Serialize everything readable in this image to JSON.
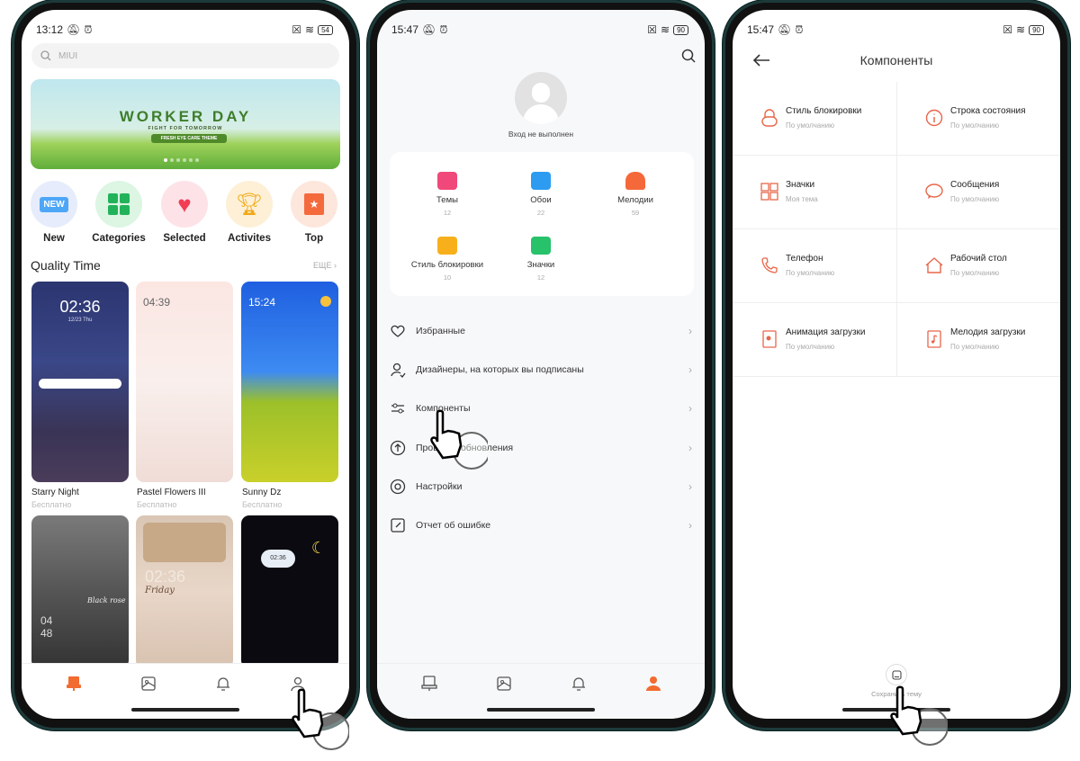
{
  "home": {
    "status": {
      "time": "13:12",
      "battery": "54"
    },
    "search": {
      "placeholder": "MIUI"
    },
    "banner": {
      "title": "WORKER DAY",
      "subtitle": "FIGHT FOR TOMORROW",
      "badge": "FRESH EYE CARE THEME"
    },
    "categories": [
      {
        "label": "New",
        "icon": "new-badge-icon"
      },
      {
        "label": "Categories",
        "icon": "grid-icon"
      },
      {
        "label": "Selected",
        "icon": "heart-icon"
      },
      {
        "label": "Activites",
        "icon": "trophy-icon"
      },
      {
        "label": "Top",
        "icon": "ribbon-star-icon"
      }
    ],
    "section": {
      "title": "Quality Time",
      "more": "ЕЩЕ"
    },
    "themes": [
      {
        "name": "Starry Night",
        "price": "Бесплатно",
        "clock": "02:36",
        "date": "12/23 Thu"
      },
      {
        "name": "Pastel Flowers III",
        "price": "Бесплатно",
        "clock": "04:39"
      },
      {
        "name": "Sunny Dz",
        "price": "Бесплатно",
        "clock": "15:24"
      },
      {
        "clock": "04 48",
        "caption": "Black rose"
      },
      {
        "clock": "02:36",
        "caption": "Friday"
      },
      {
        "clock": "02:36"
      }
    ],
    "nav": [
      "themes",
      "wallpapers",
      "ringtones",
      "profile"
    ],
    "accent": "#f26b2f"
  },
  "profile": {
    "status": {
      "time": "15:47",
      "battery": "90"
    },
    "login_text": "Вход не выполнен",
    "grid": [
      {
        "label": "Темы",
        "count": "12",
        "color": "#f0487a"
      },
      {
        "label": "Обои",
        "count": "22",
        "color": "#2d9cf0"
      },
      {
        "label": "Мелодии",
        "count": "59",
        "color": "#f5683a"
      },
      {
        "label": "Стиль блокировки",
        "count": "10",
        "color": "#f7b01c"
      },
      {
        "label": "Значки",
        "count": "12",
        "color": "#27c26a"
      }
    ],
    "menu": [
      {
        "label": "Избранные",
        "icon": "heart-icon"
      },
      {
        "label": "Дизайнеры, на которых вы подписаны",
        "icon": "user-check-icon"
      },
      {
        "label": "Компоненты",
        "icon": "sliders-icon"
      },
      {
        "label": "Проверка обновления",
        "icon": "arrow-up-circle-icon"
      },
      {
        "label": "Настройки",
        "icon": "settings-icon"
      },
      {
        "label": "Отчет об ошибке",
        "icon": "edit-square-icon"
      }
    ]
  },
  "components": {
    "status": {
      "time": "15:47",
      "battery": "90"
    },
    "title": "Компоненты",
    "items": [
      {
        "title": "Стиль блокировки",
        "sub": "По умолчанию",
        "icon": "lock-icon"
      },
      {
        "title": "Строка состояния",
        "sub": "По умолчанию",
        "icon": "info-icon"
      },
      {
        "title": "Значки",
        "sub": "Моя тема",
        "icon": "grid-icon"
      },
      {
        "title": "Сообщения",
        "sub": "По умолчанию",
        "icon": "chat-icon"
      },
      {
        "title": "Телефон",
        "sub": "По умолчанию",
        "icon": "phone-icon"
      },
      {
        "title": "Рабочий стол",
        "sub": "По умолчанию",
        "icon": "home-icon"
      },
      {
        "title": "Анимация загрузки",
        "sub": "По умолчанию",
        "icon": "boot-animation-icon"
      },
      {
        "title": "Мелодия загрузки",
        "sub": "По умолчанию",
        "icon": "music-file-icon"
      }
    ],
    "save_label": "Сохранить тему",
    "accent": "#e8664a"
  }
}
